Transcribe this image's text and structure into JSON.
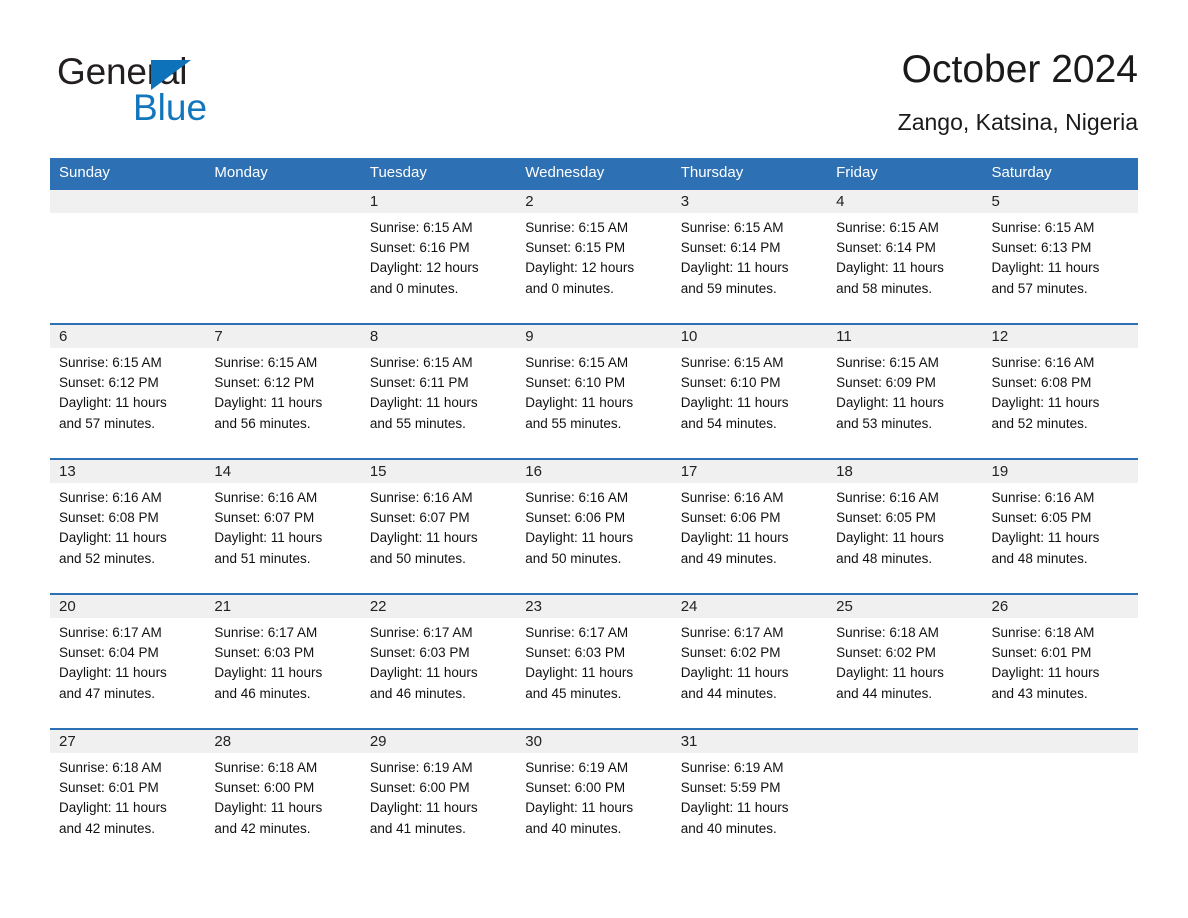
{
  "brand": {
    "name_part1": "General",
    "name_part2": "Blue",
    "triangle_icon": "triangle-icon",
    "color_black": "#231f20",
    "color_blue": "#1276bd"
  },
  "header": {
    "month_title": "October 2024",
    "location": "Zango, Katsina, Nigeria"
  },
  "theme": {
    "header_blue": "#2d70b3",
    "row_divider_blue": "#2d70b3",
    "daynum_band_gray": "#f0f0f0",
    "text_color": "#111111"
  },
  "weekdays": [
    "Sunday",
    "Monday",
    "Tuesday",
    "Wednesday",
    "Thursday",
    "Friday",
    "Saturday"
  ],
  "weeks": [
    [
      {
        "day": "",
        "sunrise": "",
        "sunset": "",
        "daylight_line1": "",
        "daylight_line2": ""
      },
      {
        "day": "",
        "sunrise": "",
        "sunset": "",
        "daylight_line1": "",
        "daylight_line2": ""
      },
      {
        "day": "1",
        "sunrise": "Sunrise: 6:15 AM",
        "sunset": "Sunset: 6:16 PM",
        "daylight_line1": "Daylight: 12 hours",
        "daylight_line2": "and 0 minutes."
      },
      {
        "day": "2",
        "sunrise": "Sunrise: 6:15 AM",
        "sunset": "Sunset: 6:15 PM",
        "daylight_line1": "Daylight: 12 hours",
        "daylight_line2": "and 0 minutes."
      },
      {
        "day": "3",
        "sunrise": "Sunrise: 6:15 AM",
        "sunset": "Sunset: 6:14 PM",
        "daylight_line1": "Daylight: 11 hours",
        "daylight_line2": "and 59 minutes."
      },
      {
        "day": "4",
        "sunrise": "Sunrise: 6:15 AM",
        "sunset": "Sunset: 6:14 PM",
        "daylight_line1": "Daylight: 11 hours",
        "daylight_line2": "and 58 minutes."
      },
      {
        "day": "5",
        "sunrise": "Sunrise: 6:15 AM",
        "sunset": "Sunset: 6:13 PM",
        "daylight_line1": "Daylight: 11 hours",
        "daylight_line2": "and 57 minutes."
      }
    ],
    [
      {
        "day": "6",
        "sunrise": "Sunrise: 6:15 AM",
        "sunset": "Sunset: 6:12 PM",
        "daylight_line1": "Daylight: 11 hours",
        "daylight_line2": "and 57 minutes."
      },
      {
        "day": "7",
        "sunrise": "Sunrise: 6:15 AM",
        "sunset": "Sunset: 6:12 PM",
        "daylight_line1": "Daylight: 11 hours",
        "daylight_line2": "and 56 minutes."
      },
      {
        "day": "8",
        "sunrise": "Sunrise: 6:15 AM",
        "sunset": "Sunset: 6:11 PM",
        "daylight_line1": "Daylight: 11 hours",
        "daylight_line2": "and 55 minutes."
      },
      {
        "day": "9",
        "sunrise": "Sunrise: 6:15 AM",
        "sunset": "Sunset: 6:10 PM",
        "daylight_line1": "Daylight: 11 hours",
        "daylight_line2": "and 55 minutes."
      },
      {
        "day": "10",
        "sunrise": "Sunrise: 6:15 AM",
        "sunset": "Sunset: 6:10 PM",
        "daylight_line1": "Daylight: 11 hours",
        "daylight_line2": "and 54 minutes."
      },
      {
        "day": "11",
        "sunrise": "Sunrise: 6:15 AM",
        "sunset": "Sunset: 6:09 PM",
        "daylight_line1": "Daylight: 11 hours",
        "daylight_line2": "and 53 minutes."
      },
      {
        "day": "12",
        "sunrise": "Sunrise: 6:16 AM",
        "sunset": "Sunset: 6:08 PM",
        "daylight_line1": "Daylight: 11 hours",
        "daylight_line2": "and 52 minutes."
      }
    ],
    [
      {
        "day": "13",
        "sunrise": "Sunrise: 6:16 AM",
        "sunset": "Sunset: 6:08 PM",
        "daylight_line1": "Daylight: 11 hours",
        "daylight_line2": "and 52 minutes."
      },
      {
        "day": "14",
        "sunrise": "Sunrise: 6:16 AM",
        "sunset": "Sunset: 6:07 PM",
        "daylight_line1": "Daylight: 11 hours",
        "daylight_line2": "and 51 minutes."
      },
      {
        "day": "15",
        "sunrise": "Sunrise: 6:16 AM",
        "sunset": "Sunset: 6:07 PM",
        "daylight_line1": "Daylight: 11 hours",
        "daylight_line2": "and 50 minutes."
      },
      {
        "day": "16",
        "sunrise": "Sunrise: 6:16 AM",
        "sunset": "Sunset: 6:06 PM",
        "daylight_line1": "Daylight: 11 hours",
        "daylight_line2": "and 50 minutes."
      },
      {
        "day": "17",
        "sunrise": "Sunrise: 6:16 AM",
        "sunset": "Sunset: 6:06 PM",
        "daylight_line1": "Daylight: 11 hours",
        "daylight_line2": "and 49 minutes."
      },
      {
        "day": "18",
        "sunrise": "Sunrise: 6:16 AM",
        "sunset": "Sunset: 6:05 PM",
        "daylight_line1": "Daylight: 11 hours",
        "daylight_line2": "and 48 minutes."
      },
      {
        "day": "19",
        "sunrise": "Sunrise: 6:16 AM",
        "sunset": "Sunset: 6:05 PM",
        "daylight_line1": "Daylight: 11 hours",
        "daylight_line2": "and 48 minutes."
      }
    ],
    [
      {
        "day": "20",
        "sunrise": "Sunrise: 6:17 AM",
        "sunset": "Sunset: 6:04 PM",
        "daylight_line1": "Daylight: 11 hours",
        "daylight_line2": "and 47 minutes."
      },
      {
        "day": "21",
        "sunrise": "Sunrise: 6:17 AM",
        "sunset": "Sunset: 6:03 PM",
        "daylight_line1": "Daylight: 11 hours",
        "daylight_line2": "and 46 minutes."
      },
      {
        "day": "22",
        "sunrise": "Sunrise: 6:17 AM",
        "sunset": "Sunset: 6:03 PM",
        "daylight_line1": "Daylight: 11 hours",
        "daylight_line2": "and 46 minutes."
      },
      {
        "day": "23",
        "sunrise": "Sunrise: 6:17 AM",
        "sunset": "Sunset: 6:03 PM",
        "daylight_line1": "Daylight: 11 hours",
        "daylight_line2": "and 45 minutes."
      },
      {
        "day": "24",
        "sunrise": "Sunrise: 6:17 AM",
        "sunset": "Sunset: 6:02 PM",
        "daylight_line1": "Daylight: 11 hours",
        "daylight_line2": "and 44 minutes."
      },
      {
        "day": "25",
        "sunrise": "Sunrise: 6:18 AM",
        "sunset": "Sunset: 6:02 PM",
        "daylight_line1": "Daylight: 11 hours",
        "daylight_line2": "and 44 minutes."
      },
      {
        "day": "26",
        "sunrise": "Sunrise: 6:18 AM",
        "sunset": "Sunset: 6:01 PM",
        "daylight_line1": "Daylight: 11 hours",
        "daylight_line2": "and 43 minutes."
      }
    ],
    [
      {
        "day": "27",
        "sunrise": "Sunrise: 6:18 AM",
        "sunset": "Sunset: 6:01 PM",
        "daylight_line1": "Daylight: 11 hours",
        "daylight_line2": "and 42 minutes."
      },
      {
        "day": "28",
        "sunrise": "Sunrise: 6:18 AM",
        "sunset": "Sunset: 6:00 PM",
        "daylight_line1": "Daylight: 11 hours",
        "daylight_line2": "and 42 minutes."
      },
      {
        "day": "29",
        "sunrise": "Sunrise: 6:19 AM",
        "sunset": "Sunset: 6:00 PM",
        "daylight_line1": "Daylight: 11 hours",
        "daylight_line2": "and 41 minutes."
      },
      {
        "day": "30",
        "sunrise": "Sunrise: 6:19 AM",
        "sunset": "Sunset: 6:00 PM",
        "daylight_line1": "Daylight: 11 hours",
        "daylight_line2": "and 40 minutes."
      },
      {
        "day": "31",
        "sunrise": "Sunrise: 6:19 AM",
        "sunset": "Sunset: 5:59 PM",
        "daylight_line1": "Daylight: 11 hours",
        "daylight_line2": "and 40 minutes."
      },
      {
        "day": "",
        "sunrise": "",
        "sunset": "",
        "daylight_line1": "",
        "daylight_line2": ""
      },
      {
        "day": "",
        "sunrise": "",
        "sunset": "",
        "daylight_line1": "",
        "daylight_line2": ""
      }
    ]
  ]
}
